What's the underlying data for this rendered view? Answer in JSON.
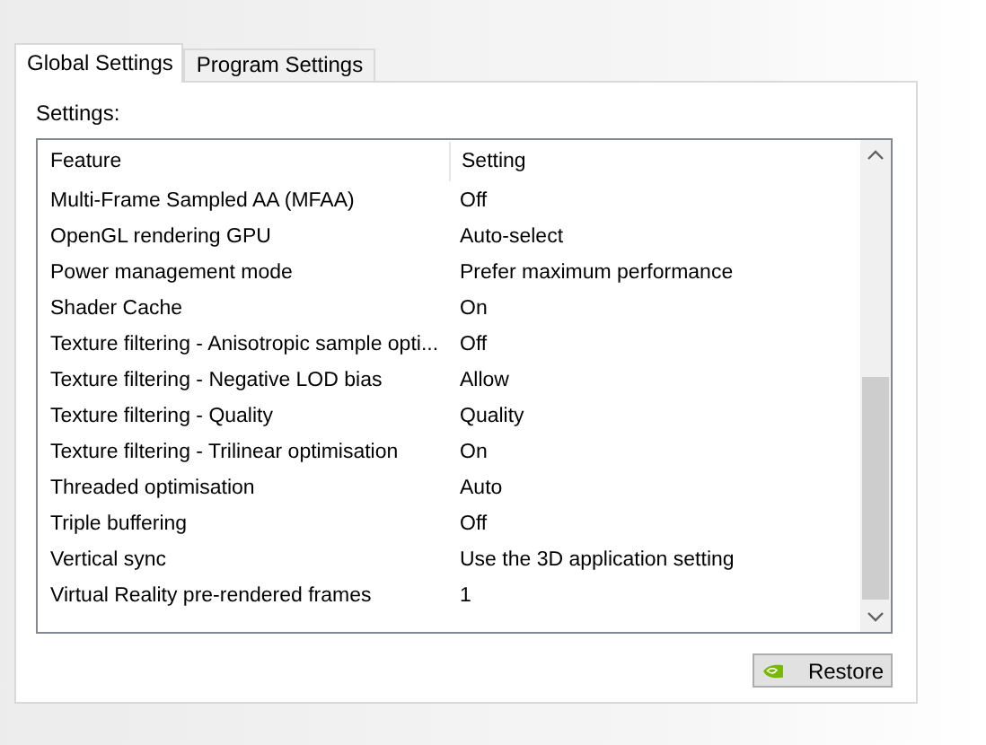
{
  "tabs": [
    {
      "label": "Global Settings",
      "selected": true
    },
    {
      "label": "Program Settings",
      "selected": false
    }
  ],
  "settings_label": "Settings:",
  "table": {
    "columns": [
      "Feature",
      "Setting"
    ],
    "rows": [
      [
        "Multi-Frame Sampled AA (MFAA)",
        "Off"
      ],
      [
        "OpenGL rendering GPU",
        "Auto-select"
      ],
      [
        "Power management mode",
        "Prefer maximum performance"
      ],
      [
        "Shader Cache",
        "On"
      ],
      [
        "Texture filtering - Anisotropic sample opti...",
        "Off"
      ],
      [
        "Texture filtering - Negative LOD bias",
        "Allow"
      ],
      [
        "Texture filtering - Quality",
        "Quality"
      ],
      [
        "Texture filtering - Trilinear optimisation",
        "On"
      ],
      [
        "Threaded optimisation",
        "Auto"
      ],
      [
        "Triple buffering",
        "Off"
      ],
      [
        "Vertical sync",
        "Use the 3D application setting"
      ],
      [
        "Virtual Reality pre-rendered frames",
        "1"
      ]
    ]
  },
  "buttons": [
    {
      "label": "Restore"
    }
  ]
}
